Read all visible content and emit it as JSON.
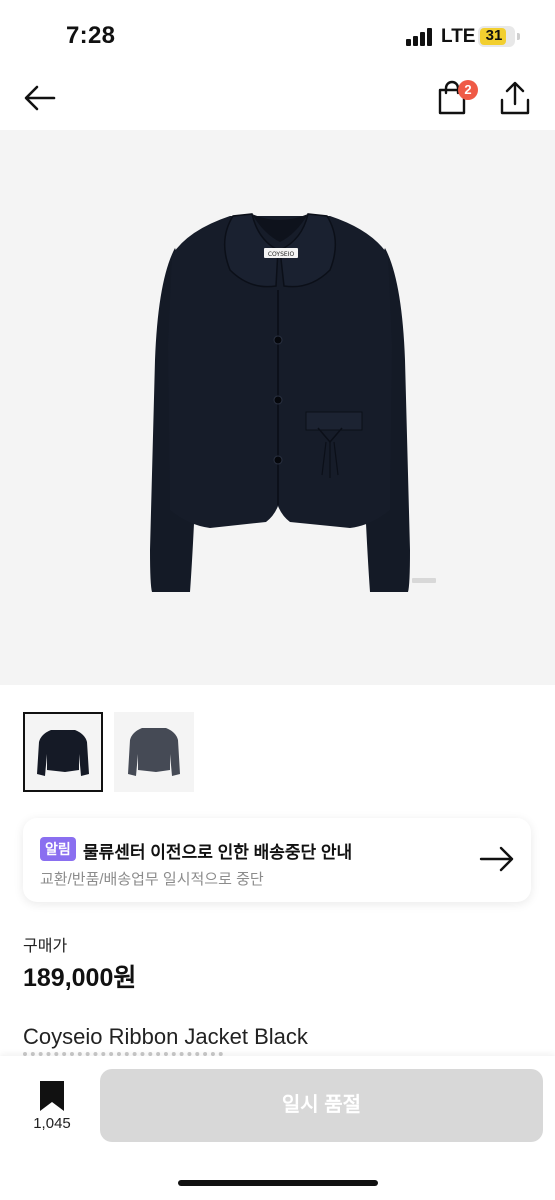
{
  "status_bar": {
    "time": "7:28",
    "network": "LTE",
    "battery": "31",
    "battery_color": "#f2cf2f"
  },
  "nav": {
    "back_icon": "arrow-left-icon",
    "cart_icon": "shopping-bag-icon",
    "cart_count": "2",
    "share_icon": "share-icon",
    "badge_color": "#ef5a46"
  },
  "product": {
    "hero_image": "black jacket with collar and bow pocket",
    "brand_tag": "COYSEIO",
    "thumbnails": [
      {
        "color": "black",
        "selected": true
      },
      {
        "color": "charcoal",
        "selected": false
      }
    ]
  },
  "notice": {
    "badge": "알림",
    "title": "물류센터 이전으로 인한 배송중단 안내",
    "subtitle": "교환/반품/배송업무 일시적으로 중단",
    "arrow_icon": "arrow-right-icon",
    "badge_color": "#8a6ff0"
  },
  "price": {
    "label": "구매가",
    "value": "189,000원"
  },
  "product_info": {
    "name": "Coyseio Ribbon Jacket Black"
  },
  "bottom_bar": {
    "bookmark_icon": "bookmark-icon",
    "bookmark_count": "1,045",
    "action_label": "일시 품절"
  }
}
